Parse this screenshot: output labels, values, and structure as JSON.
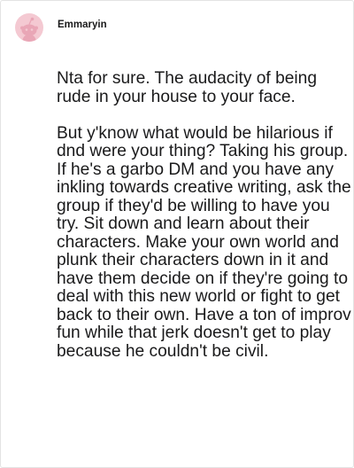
{
  "comment": {
    "username": "Emmaryin",
    "avatar_icon": "reddit-snoo-avatar-icon",
    "avatar_bg": "#f4c9d2",
    "paragraphs": [
      "Nta for sure. The audacity of being rude in your house to your face.",
      "But y'know what would be hilarious if dnd were your thing? Taking his group. If he's a garbo DM and you have any inkling towards creative writing, ask the group if they'd be willing to have you try. Sit down and learn about their characters. Make your own world and plunk their characters down in it and have them decide on if they're going to deal with this new world or fight to get back to their own. Have a ton of improv fun while that jerk doesn't get to play because he couldn't be civil."
    ]
  }
}
